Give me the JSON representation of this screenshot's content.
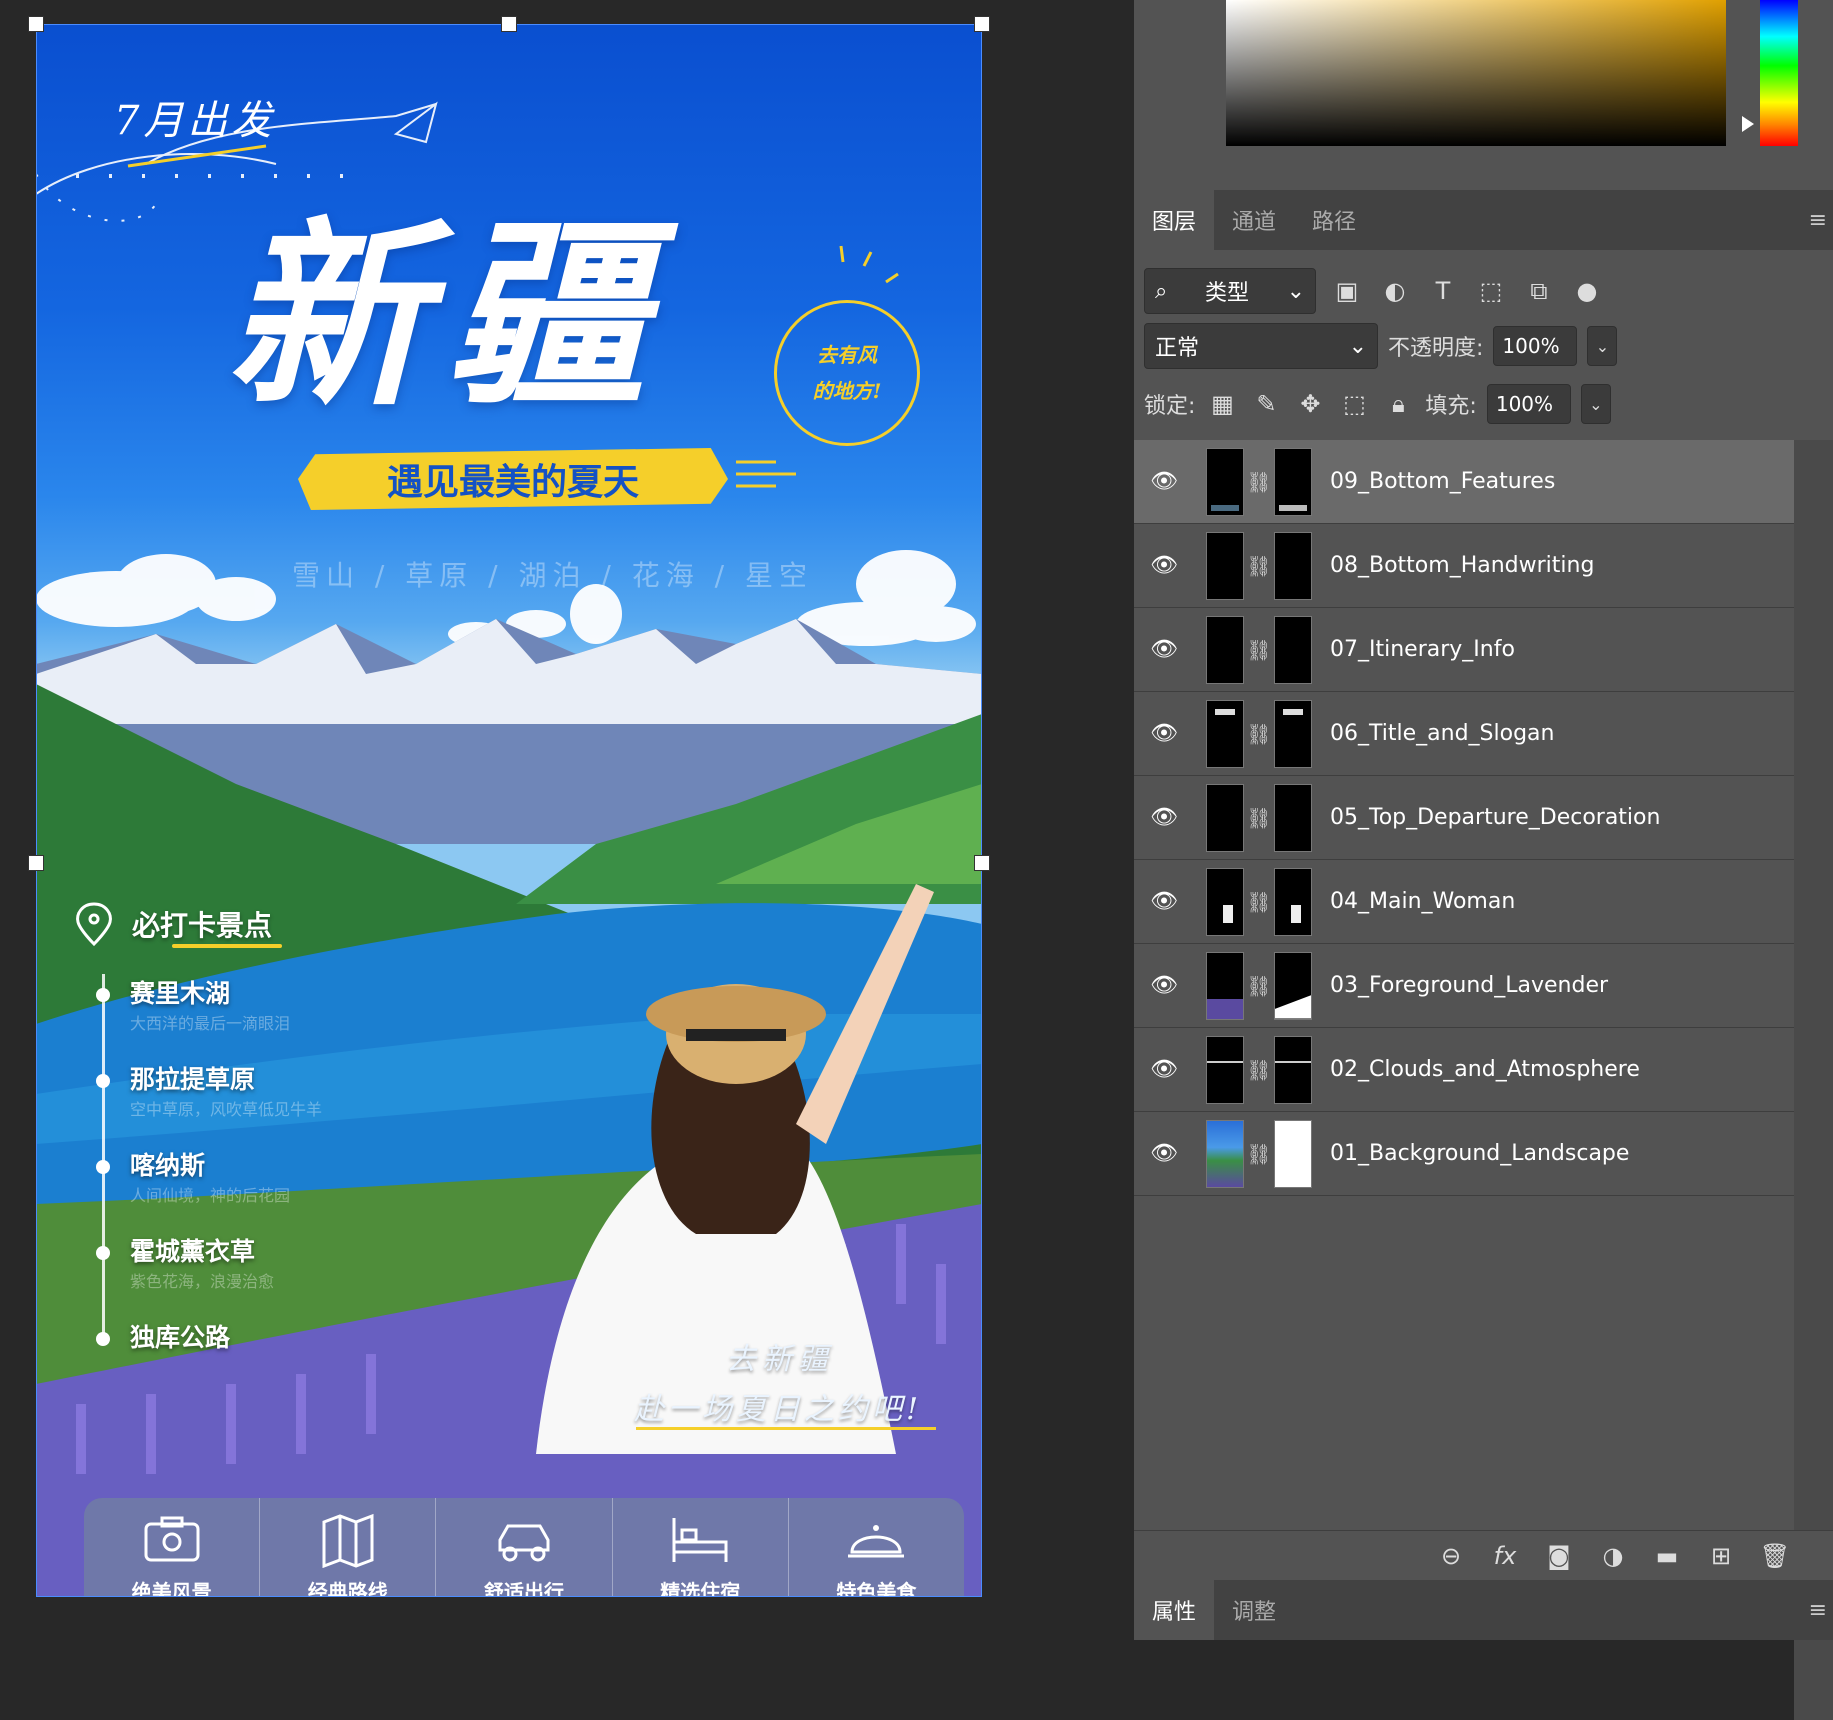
{
  "poster": {
    "departure": "7月出发",
    "title": "新疆",
    "badge_line1": "去有风",
    "badge_line2": "的地方!",
    "slogan": "遇见最美的夏天",
    "subtitle": "雪山 / 草原 / 湖泊 / 花海 / 星空",
    "spots_title": "必打卡景点",
    "spots": [
      {
        "name": "赛里木湖",
        "desc": "大西洋的最后一滴眼泪"
      },
      {
        "name": "那拉提草原",
        "desc": "空中草原，风吹草低见牛羊"
      },
      {
        "name": "喀纳斯",
        "desc": "人间仙境，神的后花园"
      },
      {
        "name": "霍城薰衣草",
        "desc": "紫色花海，浪漫治愈"
      },
      {
        "name": "独库公路",
        "desc": ""
      }
    ],
    "handwriting_line1": "去新疆",
    "handwriting_line2": "赴一场夏日之约吧!",
    "features": [
      {
        "label": "绝美风景",
        "icon": "camera-icon"
      },
      {
        "label": "经典路线",
        "icon": "map-icon"
      },
      {
        "label": "舒适出行",
        "icon": "car-icon"
      },
      {
        "label": "精选住宿",
        "icon": "bed-icon"
      },
      {
        "label": "特色美食",
        "icon": "dish-icon"
      }
    ]
  },
  "layers_panel": {
    "tabs": [
      "图层",
      "通道",
      "路径"
    ],
    "filter_label": "类型",
    "blend_mode": "正常",
    "opacity_label": "不透明度:",
    "opacity_value": "100%",
    "lock_label": "锁定:",
    "fill_label": "填充:",
    "fill_value": "100%",
    "layers": [
      {
        "name": "09_Bottom_Features",
        "selected": true
      },
      {
        "name": "08_Bottom_Handwriting",
        "selected": false
      },
      {
        "name": "07_Itinerary_Info",
        "selected": false
      },
      {
        "name": "06_Title_and_Slogan",
        "selected": false
      },
      {
        "name": "05_Top_Departure_Decoration",
        "selected": false
      },
      {
        "name": "04_Main_Woman",
        "selected": false
      },
      {
        "name": "03_Foreground_Lavender",
        "selected": false
      },
      {
        "name": "02_Clouds_and_Atmosphere",
        "selected": false
      },
      {
        "name": "01_Background_Landscape",
        "selected": false
      }
    ]
  },
  "properties_panel": {
    "tabs": [
      "属性",
      "调整"
    ]
  },
  "colors": {
    "accent_yellow": "#f5cf2a",
    "sky_blue": "#1466e0",
    "panel_bg": "#535353",
    "selection_blue": "#4a8cff"
  }
}
